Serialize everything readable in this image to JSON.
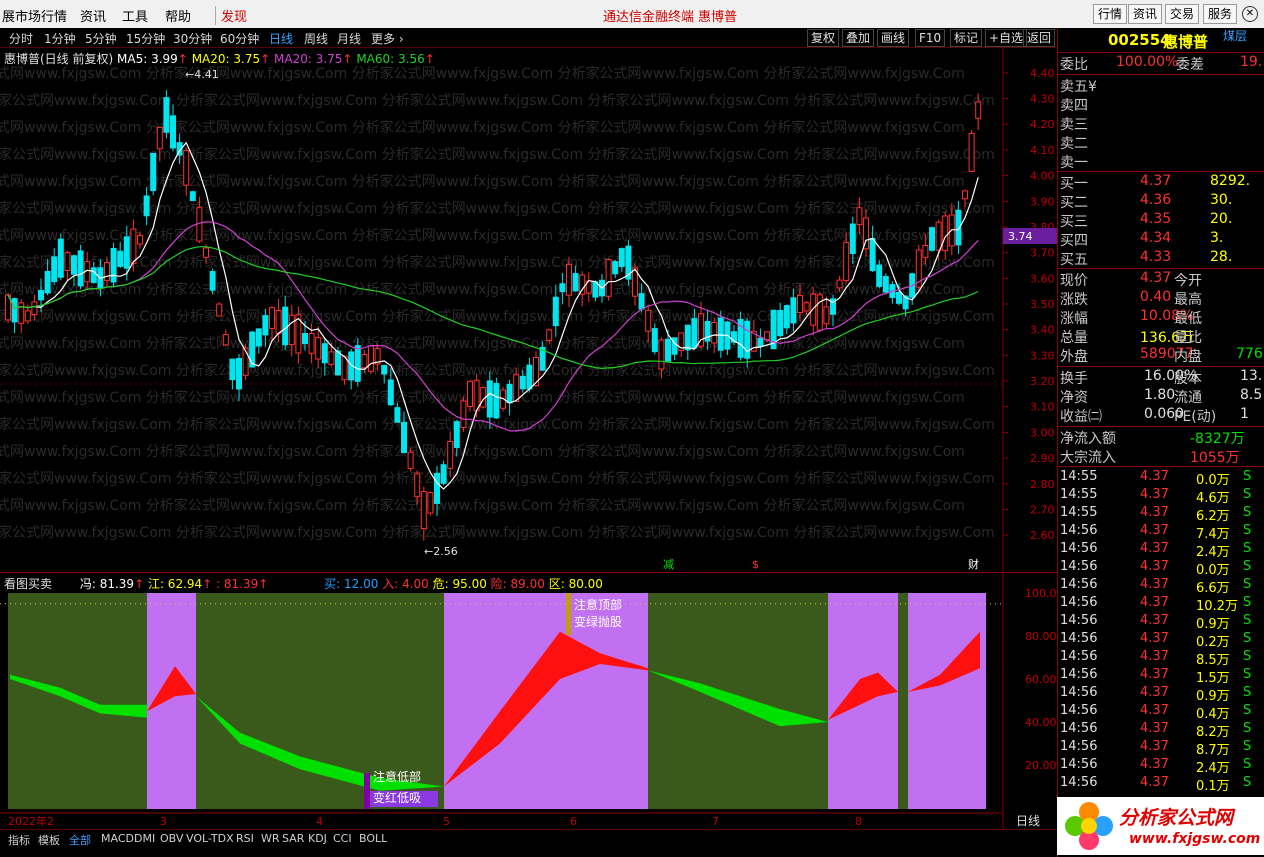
{
  "menubar": {
    "items": [
      "展市场行情",
      "资讯",
      "工具",
      "帮助",
      "发现"
    ],
    "title": "通达信金融终端",
    "stock_title": "惠博普",
    "right_buttons": [
      "行情",
      "资讯",
      "交易",
      "服务"
    ]
  },
  "period_toolbar": {
    "periods": [
      "分时",
      "1分钟",
      "5分钟",
      "15分钟",
      "30分钟",
      "60分钟",
      "日线",
      "周线",
      "月线",
      "更多 ›"
    ],
    "active": "日线",
    "buttons": [
      "复权",
      "叠加",
      "画线",
      "F10",
      "标记",
      "+自选",
      "返回"
    ]
  },
  "price_chart": {
    "header": {
      "name": "惠博普(日线 前复权)",
      "ma5": "MA5: 3.99",
      "ma10": "MA20: 3.75",
      "ma20": "MA20: 3.75",
      "ma60": "MA60: 3.56"
    },
    "high_label": "4.41",
    "low_label": "2.56",
    "last_tag": "3.74",
    "markers": [
      "减",
      "$",
      "财"
    ],
    "y_ticks": [
      "4.40",
      "4.30",
      "4.20",
      "4.10",
      "4.00",
      "3.90",
      "3.80",
      "3.70",
      "3.60",
      "3.50",
      "3.40",
      "3.30",
      "3.20",
      "3.10",
      "3.00",
      "2.90",
      "2.80",
      "2.70",
      "2.60"
    ],
    "watermark": "分析家公式网www.fxjgsw.Com"
  },
  "indicator_chart": {
    "header": {
      "name": "看图买卖",
      "feng": "冯: 81.39",
      "jiang": "江: 62.94",
      "third": ": 81.39",
      "buy": "买: 12.00",
      "ru": "入: 4.00",
      "wei": "危: 95.00",
      "xian": "险: 89.00",
      "qu": "区: 80.00"
    },
    "notes": {
      "top1": "注意顶部",
      "top2": "变绿抛股",
      "low1": "注意低部",
      "low2": "变红低吸"
    },
    "y_ticks": [
      "100.00",
      "80.00",
      "60.00",
      "40.00",
      "20.00"
    ],
    "x_labels": [
      "2022年2",
      "3",
      "4",
      "5",
      "6",
      "7",
      "8"
    ],
    "period_label": "日线"
  },
  "bottom_tabs": [
    "指标",
    "模板",
    "全部",
    "MACD",
    "DMI",
    "OBV",
    "VOL-TDX",
    "RSI",
    "WR",
    "SAR",
    "KDJ",
    "CCI",
    "BOLL"
  ],
  "quote": {
    "code": "002554",
    "name": "惠博普",
    "tag": "煤层",
    "weibi_label": "委比",
    "weibi": "100.00%",
    "weicha_label": "委差",
    "weicha": "19.",
    "sells": [
      {
        "label": "卖五",
        "p": "",
        "v": "",
        "mark": "¥"
      },
      {
        "label": "卖四",
        "p": "",
        "v": ""
      },
      {
        "label": "卖三",
        "p": "",
        "v": ""
      },
      {
        "label": "卖二",
        "p": "",
        "v": ""
      },
      {
        "label": "卖一",
        "p": "",
        "v": ""
      }
    ],
    "buys": [
      {
        "label": "买一",
        "p": "4.37",
        "v": "8292."
      },
      {
        "label": "买二",
        "p": "4.36",
        "v": "30."
      },
      {
        "label": "买三",
        "p": "4.35",
        "v": "20."
      },
      {
        "label": "买四",
        "p": "4.34",
        "v": "3."
      },
      {
        "label": "买五",
        "p": "4.33",
        "v": "28."
      }
    ],
    "stats": [
      {
        "l": "现价",
        "v": "4.37",
        "l2": "今开",
        "v2": "",
        "c": "#ff3030"
      },
      {
        "l": "涨跌",
        "v": "0.40",
        "l2": "最高",
        "v2": "",
        "c": "#ff3030"
      },
      {
        "l": "涨幅",
        "v": "10.08%",
        "l2": "最低",
        "v2": "",
        "c": "#ff3030"
      },
      {
        "l": "总量",
        "v": "136.6万",
        "l2": "量比",
        "v2": "",
        "c": "#ffff00"
      },
      {
        "l": "外盘",
        "v": "589077",
        "l2": "内盘",
        "v2": "776",
        "c": "#ff3030",
        "c2": "#00e000"
      }
    ],
    "stats2": [
      {
        "l": "换手",
        "v": "16.00%",
        "l2": "股本",
        "v2": "13."
      },
      {
        "l": "净资",
        "v": "1.80",
        "l2": "流通",
        "v2": "8.5"
      },
      {
        "l": "收益㈡",
        "v": "0.060",
        "l2": "PE(动)",
        "v2": "1"
      }
    ],
    "flow": [
      {
        "l": "净流入额",
        "v": "-8327万",
        "c": "#00e000"
      },
      {
        "l": "大宗流入",
        "v": "1055万",
        "c": "#ff3030"
      }
    ],
    "ticks": [
      [
        "14:55",
        "4.37",
        "0.0万",
        "S"
      ],
      [
        "14:55",
        "4.37",
        "4.6万",
        "S"
      ],
      [
        "14:55",
        "4.37",
        "6.2万",
        "S"
      ],
      [
        "14:56",
        "4.37",
        "7.4万",
        "S"
      ],
      [
        "14:56",
        "4.37",
        "2.4万",
        "S"
      ],
      [
        "14:56",
        "4.37",
        "0.0万",
        "S"
      ],
      [
        "14:56",
        "4.37",
        "6.6万",
        "S"
      ],
      [
        "14:56",
        "4.37",
        "10.2万",
        "S"
      ],
      [
        "14:56",
        "4.37",
        "0.9万",
        "S"
      ],
      [
        "14:56",
        "4.37",
        "0.2万",
        "S"
      ],
      [
        "14:56",
        "4.37",
        "8.5万",
        "S"
      ],
      [
        "14:56",
        "4.37",
        "1.5万",
        "S"
      ],
      [
        "14:56",
        "4.37",
        "0.9万",
        "S"
      ],
      [
        "14:56",
        "4.37",
        "0.4万",
        "S"
      ],
      [
        "14:56",
        "4.37",
        "8.2万",
        "S"
      ],
      [
        "14:56",
        "4.37",
        "8.7万",
        "S"
      ],
      [
        "14:56",
        "4.37",
        "2.4万",
        "S"
      ],
      [
        "14:56",
        "4.37",
        "0.1万",
        "S"
      ]
    ]
  },
  "logo": {
    "title": "分析家公式网",
    "url": "www.fxjgsw.com"
  },
  "colors": {
    "up": "#ff3030",
    "down": "#00e5ee",
    "ma5": "#ffffff",
    "ma20": "#d040d0",
    "ma60": "#20d020",
    "zone_purple": "#c070f0",
    "zone_green": "#3a5a1c"
  }
}
